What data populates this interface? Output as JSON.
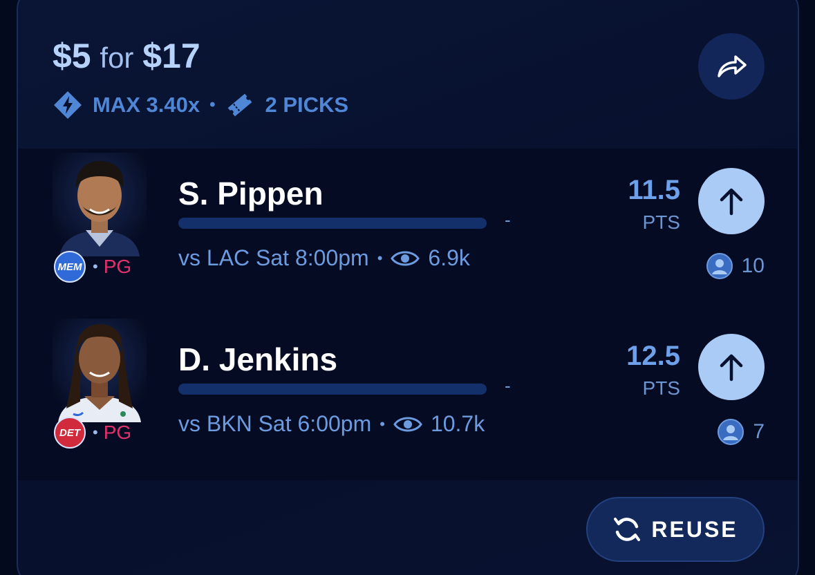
{
  "header": {
    "stake": "$5",
    "for_text": "for",
    "payout": "$17",
    "max_multiplier": "MAX 3.40x",
    "separator": "•",
    "picks_count": "2 PICKS",
    "icons": {
      "multiplier": "bolt-diamond-icon",
      "picks": "ticket-icon",
      "share": "share-arrow-icon"
    }
  },
  "picks": [
    {
      "player": "S. Pippen",
      "team": "MEM",
      "team_color": "#2f6ad8",
      "position": "PG",
      "progress_value": "-",
      "game": "vs LAC Sat 8:00pm",
      "views": "6.9k",
      "line": "11.5",
      "stat": "PTS",
      "pickers": "10",
      "direction": "up"
    },
    {
      "player": "D. Jenkins",
      "team": "DET",
      "team_color": "#d02a3c",
      "position": "PG",
      "progress_value": "-",
      "game": "vs BKN Sat 6:00pm",
      "views": "10.7k",
      "line": "12.5",
      "stat": "PTS",
      "pickers": "7",
      "direction": "up"
    }
  ],
  "actions": {
    "reuse_label": "REUSE",
    "reuse_icon": "refresh-icon"
  },
  "colors": {
    "accent": "#a9cbf5",
    "background": "#040a1e",
    "position": "#e0336e",
    "muted": "#6d9be0"
  }
}
